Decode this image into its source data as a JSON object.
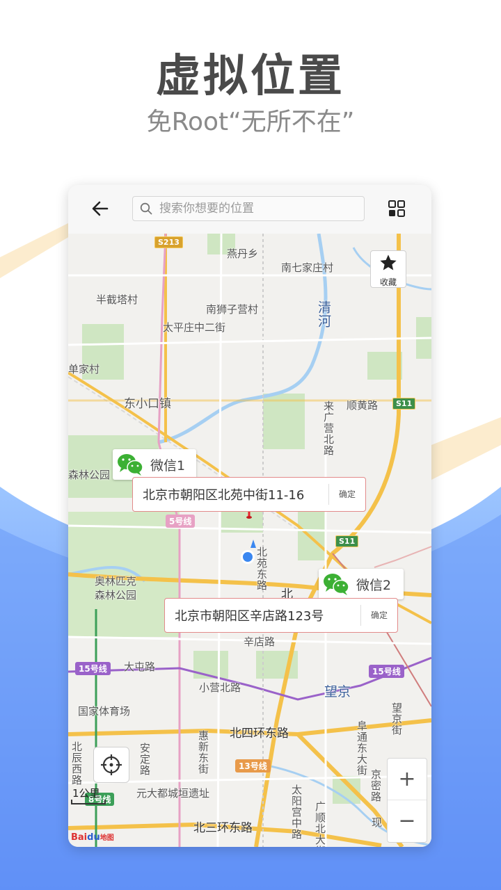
{
  "promo": {
    "title": "虚拟位置",
    "subtitle": "免Root“无所不在”"
  },
  "topbar": {
    "search_placeholder": "搜索你想要的位置",
    "icons": {
      "back": "back-arrow-icon",
      "search": "search-icon",
      "grid": "grid-icon"
    }
  },
  "favorite": {
    "label": "收藏",
    "icon": "star-icon"
  },
  "markers": [
    {
      "name": "微信1",
      "address": "北京市朝阳区北苑中街11-16",
      "confirm": "确定"
    },
    {
      "name": "微信2",
      "address": "北京市朝阳区辛店路123号",
      "confirm": "确定"
    }
  ],
  "map_labels": {
    "yandan": "燕丹乡",
    "nanqijia": "南七家庄村",
    "bandaita": "半截塔村",
    "nanshizi": "南狮子营村",
    "qinghe": "清河",
    "taipingzhuang": "太平庄中二街",
    "shanjia": "单家村",
    "dongxiaokou": "东小口镇",
    "laiguangying": "来广营北路",
    "shunhuang": "顺黄路",
    "senlin": "森林公园",
    "olympic": "奥林匹克森林公园",
    "beiyuan": "北苑东路",
    "beisi_short": "北",
    "xindian": "辛店路",
    "dadun": "大屯路",
    "xiaoying": "小营北路",
    "wangjing": "望京",
    "guojia": "国家体育场",
    "beisihuan": "北四环东路",
    "beichen": "北辰西路",
    "anding": "安定路",
    "huixin": "惠新东街",
    "wangjingjie": "望京街",
    "fushi": "阜通东大街",
    "jingmi": "京密路",
    "yuandadu": "元大都城垣遗址",
    "taiyanggong": "太阳宫中路",
    "beisanhuan": "北三环东路",
    "guangshun": "广顺北大街",
    "xian": "现"
  },
  "line_badges": {
    "s213": "S213",
    "s11a": "S11",
    "s11b": "S11",
    "line5": "5号线",
    "line15a": "15号线",
    "line15b": "15号线",
    "line13": "13号线",
    "line8": "8号线"
  },
  "controls": {
    "zoom_in": "+",
    "zoom_out": "−",
    "scale": "1公里",
    "locate_icon": "crosshair-icon"
  },
  "logo": {
    "bai": "Bai",
    "du": "du",
    "map": "地图"
  },
  "colors": {
    "pin": "#e8232b",
    "wechat_green": "#3cb034",
    "blue_bg": "#5a8cf5",
    "road_yellow": "#f4c14a",
    "metro_purple": "#9a62c9",
    "river_blue": "#9ec8ee",
    "park_green": "#cfe6c2"
  }
}
